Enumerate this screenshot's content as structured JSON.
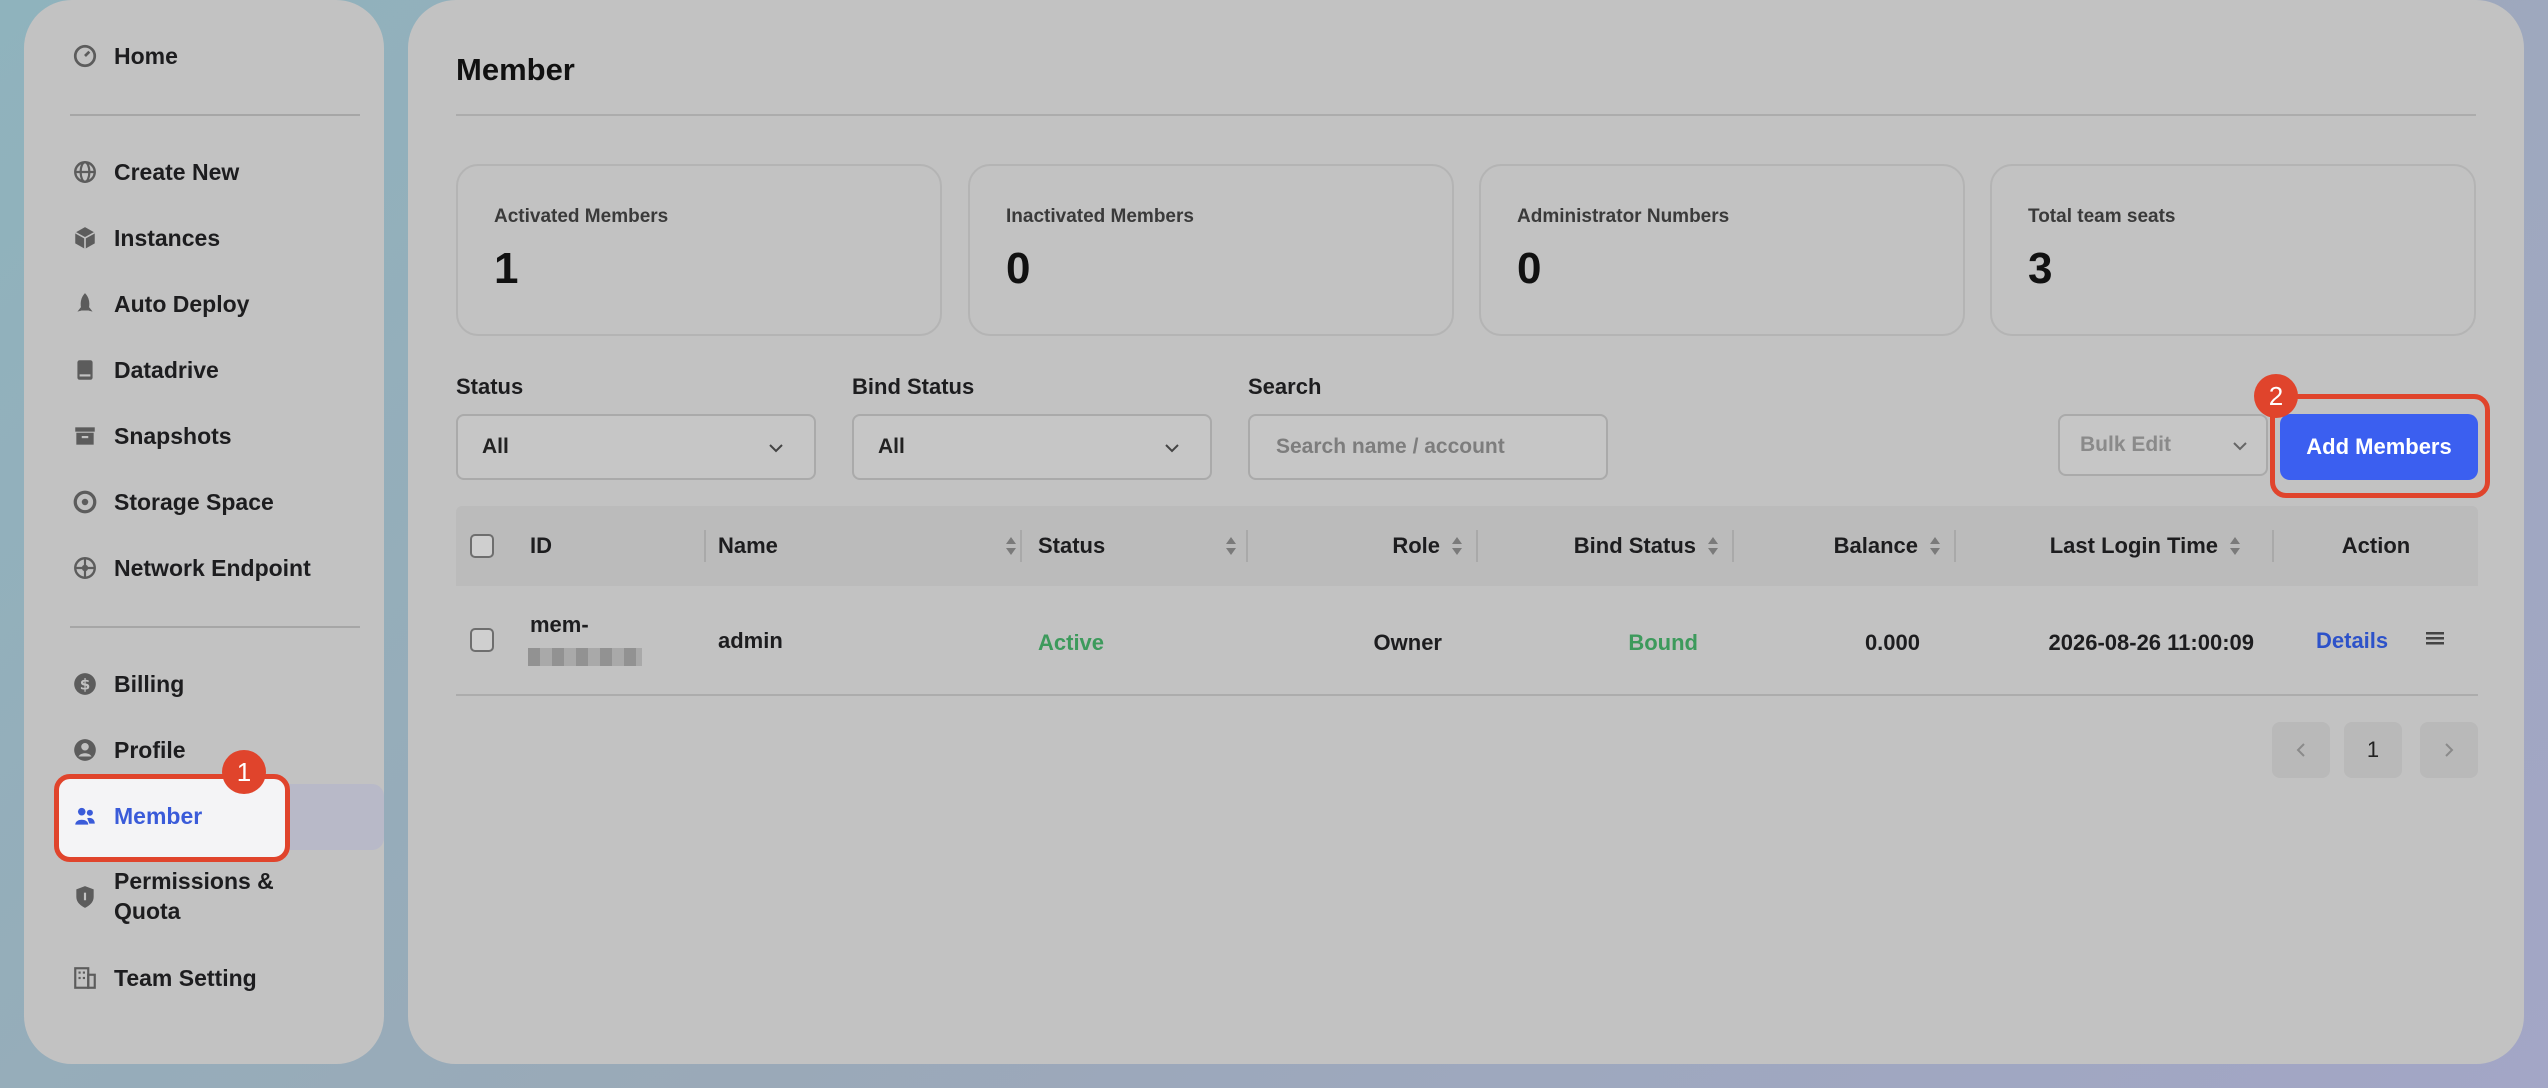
{
  "sidebar": {
    "items": [
      {
        "label": "Home",
        "icon": "dashboard-icon"
      },
      {
        "label": "Create New",
        "icon": "globe-icon"
      },
      {
        "label": "Instances",
        "icon": "cube-icon"
      },
      {
        "label": "Auto Deploy",
        "icon": "rocket-icon"
      },
      {
        "label": "Datadrive",
        "icon": "drive-icon"
      },
      {
        "label": "Snapshots",
        "icon": "archive-icon"
      },
      {
        "label": "Storage Space",
        "icon": "storage-icon"
      },
      {
        "label": "Network Endpoint",
        "icon": "network-icon"
      },
      {
        "label": "Billing",
        "icon": "dollar-icon"
      },
      {
        "label": "Profile",
        "icon": "user-icon"
      },
      {
        "label": "Member",
        "icon": "team-icon"
      },
      {
        "label": "Permissions & Quota",
        "icon": "shield-icon"
      },
      {
        "label": "Team Setting",
        "icon": "building-icon"
      }
    ],
    "active": "Member"
  },
  "annotations": {
    "badge1": "1",
    "badge2": "2"
  },
  "page": {
    "title": "Member"
  },
  "stats": [
    {
      "label": "Activated Members",
      "value": "1"
    },
    {
      "label": "Inactivated Members",
      "value": "0"
    },
    {
      "label": "Administrator Numbers",
      "value": "0"
    },
    {
      "label": "Total team seats",
      "value": "3"
    }
  ],
  "filters": {
    "status_label": "Status",
    "status_value": "All",
    "bind_label": "Bind Status",
    "bind_value": "All",
    "search_label": "Search",
    "search_placeholder": "Search name / account"
  },
  "toolbar": {
    "bulk_edit": "Bulk Edit",
    "add_members": "Add Members"
  },
  "table": {
    "headers": [
      "ID",
      "Name",
      "Status",
      "Role",
      "Bind Status",
      "Balance",
      "Last Login Time",
      "Action"
    ],
    "rows": [
      {
        "id": "mem-",
        "name": "admin",
        "status": "Active",
        "role": "Owner",
        "bind_status": "Bound",
        "balance": "0.000",
        "last_login": "2026-08-26 11:00:09",
        "action": "Details"
      }
    ]
  },
  "pagination": {
    "current": "1"
  },
  "colors": {
    "accent": "#3b5ff0",
    "highlight": "#e0442c",
    "success": "#3d9a5c"
  }
}
